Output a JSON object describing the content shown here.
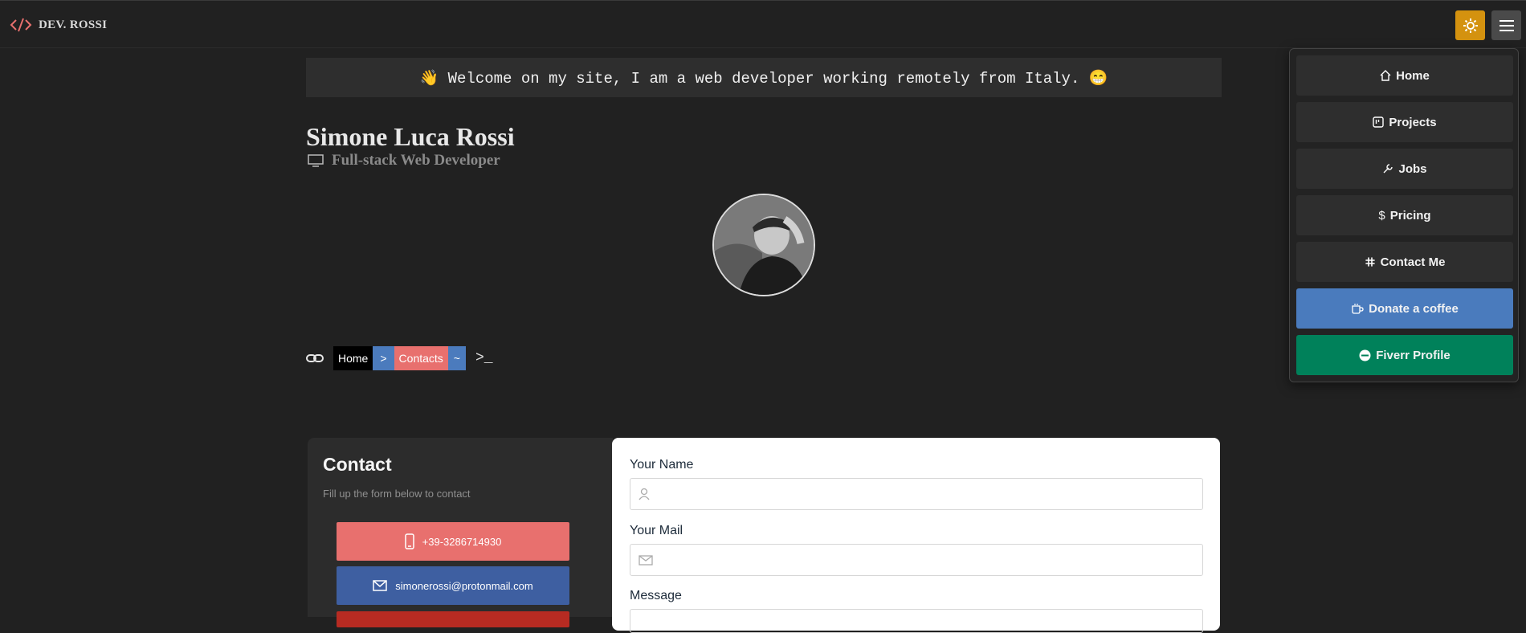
{
  "header": {
    "brand": "DEV. ROSSI",
    "theme_icon": "sun-gear-icon",
    "menu_icon": "hamburger-icon"
  },
  "welcome": {
    "text": "👋 Welcome on my site, I am a web developer working remotely from Italy. 😁"
  },
  "profile": {
    "name": "Simone Luca Rossi",
    "role": "Full-stack Web Developer",
    "role_icon": "monitor-icon"
  },
  "breadcrumb": {
    "home": "Home",
    "separator": ">",
    "current": "Contacts",
    "tilde": "~",
    "prompt": ">_"
  },
  "contact": {
    "title": "Contact",
    "subtitle": "Fill up the form below to contact",
    "phone": "+39-3286714930",
    "email": "simonerossi@protonmail.com"
  },
  "form": {
    "name_label": "Your Name",
    "name_value": "",
    "mail_label": "Your Mail",
    "mail_value": "",
    "message_label": "Message"
  },
  "menu": {
    "items": [
      {
        "label": "Home",
        "icon": "home-icon"
      },
      {
        "label": "Projects",
        "icon": "kanban-icon"
      },
      {
        "label": "Jobs",
        "icon": "wrench-icon"
      },
      {
        "label": "Pricing",
        "icon": "dollar-icon"
      },
      {
        "label": "Contact Me",
        "icon": "slack-icon"
      },
      {
        "label": "Donate a coffee",
        "icon": "coffee-icon"
      },
      {
        "label": "Fiverr Profile",
        "icon": "fiverr-icon"
      }
    ]
  },
  "colors": {
    "background": "#212121",
    "theme_button": "#d4920f",
    "phone_button": "#e8706e",
    "mail_button": "#3e5fa1",
    "coffee_button": "#4a7bbd",
    "fiverr_button": "#00815a"
  }
}
